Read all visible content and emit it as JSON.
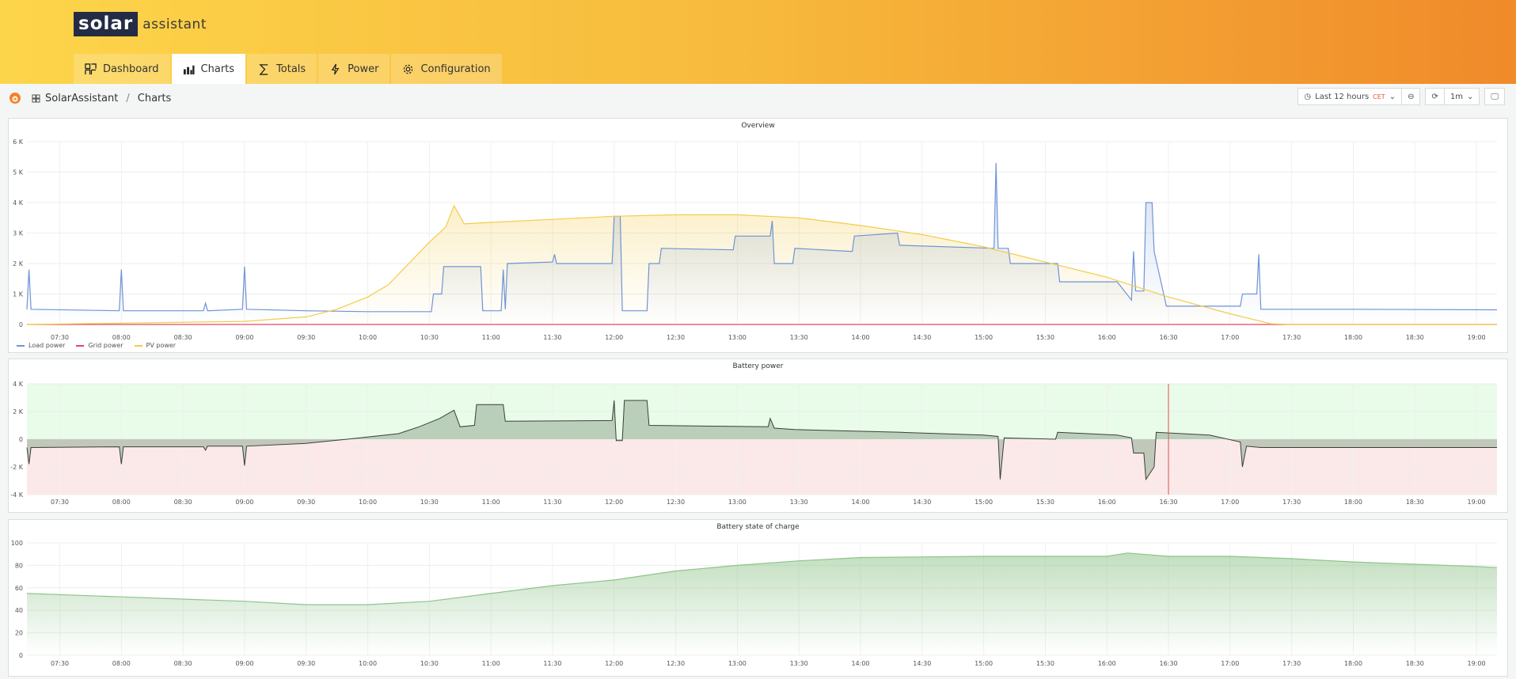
{
  "header": {
    "logo_primary": "solar",
    "logo_secondary": "assistant",
    "tabs": [
      {
        "label": "Dashboard",
        "icon": "dashboard-icon"
      },
      {
        "label": "Charts",
        "icon": "chart-icon",
        "active": true
      },
      {
        "label": "Totals",
        "icon": "sigma-icon"
      },
      {
        "label": "Power",
        "icon": "bolt-icon"
      },
      {
        "label": "Configuration",
        "icon": "gear-icon"
      }
    ]
  },
  "breadcrumb": {
    "root": "SolarAssistant",
    "separator": "/",
    "current": "Charts"
  },
  "toolbar": {
    "time_range": "Last 12 hours",
    "timezone": "CET",
    "refresh_interval": "1m"
  },
  "colors": {
    "load": "#6f93d6",
    "grid": "#e0495f",
    "pv": "#f2cc4c",
    "battery_line": "#3a3f3a",
    "battery_fill": "#9bb29b",
    "positive_zone": "#e9fbe9",
    "negative_zone": "#fbe9e9",
    "soc": "#8fc48a"
  },
  "chart_data": [
    {
      "type": "line",
      "title": "Overview",
      "xlim": [
        "07:14",
        "19:10"
      ],
      "ylim": [
        0,
        6000
      ],
      "yticks": [
        {
          "v": 0,
          "label": "0"
        },
        {
          "v": 1000,
          "label": "1 K"
        },
        {
          "v": 2000,
          "label": "2 K"
        },
        {
          "v": 3000,
          "label": "3 K"
        },
        {
          "v": 4000,
          "label": "4 K"
        },
        {
          "v": 5000,
          "label": "5 K"
        },
        {
          "v": 6000,
          "label": "6 K"
        }
      ],
      "xticks": [
        "07:30",
        "08:00",
        "08:30",
        "09:00",
        "09:30",
        "10:00",
        "10:30",
        "11:00",
        "11:30",
        "12:00",
        "12:30",
        "13:00",
        "13:30",
        "14:00",
        "14:30",
        "15:00",
        "15:30",
        "16:00",
        "16:30",
        "17:00",
        "17:30",
        "18:00",
        "18:30",
        "19:00"
      ],
      "legend": "bottom-left",
      "grid": true,
      "series": [
        {
          "name": "Load power",
          "color": "#6f93d6",
          "points": [
            [
              "07:14",
              500
            ],
            [
              "07:15",
              1800
            ],
            [
              "07:16",
              500
            ],
            [
              "07:59",
              450
            ],
            [
              "08:00",
              1800
            ],
            [
              "08:01",
              450
            ],
            [
              "08:40",
              450
            ],
            [
              "08:41",
              700
            ],
            [
              "08:42",
              450
            ],
            [
              "08:59",
              500
            ],
            [
              "09:00",
              1900
            ],
            [
              "09:01",
              500
            ],
            [
              "09:30",
              450
            ],
            [
              "10:00",
              420
            ],
            [
              "10:31",
              420
            ],
            [
              "10:32",
              1000
            ],
            [
              "10:36",
              1000
            ],
            [
              "10:37",
              1900
            ],
            [
              "10:55",
              1900
            ],
            [
              "10:56",
              450
            ],
            [
              "11:05",
              450
            ],
            [
              "11:06",
              1800
            ],
            [
              "11:07",
              500
            ],
            [
              "11:08",
              2000
            ],
            [
              "11:30",
              2050
            ],
            [
              "11:31",
              2300
            ],
            [
              "11:32",
              2000
            ],
            [
              "11:59",
              2000
            ],
            [
              "12:00",
              3550
            ],
            [
              "12:03",
              3550
            ],
            [
              "12:04",
              450
            ],
            [
              "12:16",
              450
            ],
            [
              "12:17",
              2000
            ],
            [
              "12:22",
              2000
            ],
            [
              "12:23",
              2500
            ],
            [
              "12:58",
              2450
            ],
            [
              "12:59",
              2900
            ],
            [
              "13:16",
              2900
            ],
            [
              "13:17",
              3400
            ],
            [
              "13:18",
              2000
            ],
            [
              "13:27",
              2000
            ],
            [
              "13:28",
              2500
            ],
            [
              "13:55",
              2400
            ],
            [
              "13:56",
              2400
            ],
            [
              "13:57",
              2900
            ],
            [
              "14:18",
              3000
            ],
            [
              "14:19",
              2600
            ],
            [
              "15:05",
              2500
            ],
            [
              "15:06",
              5300
            ],
            [
              "15:07",
              2500
            ],
            [
              "15:12",
              2500
            ],
            [
              "15:13",
              2000
            ],
            [
              "15:36",
              2000
            ],
            [
              "15:37",
              1400
            ],
            [
              "16:05",
              1400
            ],
            [
              "16:12",
              800
            ],
            [
              "16:13",
              2400
            ],
            [
              "16:14",
              1100
            ],
            [
              "16:18",
              1100
            ],
            [
              "16:19",
              4000
            ],
            [
              "16:22",
              4000
            ],
            [
              "16:23",
              2400
            ],
            [
              "16:29",
              600
            ],
            [
              "17:05",
              600
            ],
            [
              "17:06",
              1000
            ],
            [
              "17:13",
              1000
            ],
            [
              "17:14",
              2300
            ],
            [
              "17:15",
              500
            ],
            [
              "18:00",
              500
            ],
            [
              "19:10",
              480
            ]
          ]
        },
        {
          "name": "Grid power",
          "color": "#e0495f",
          "points": [
            [
              "07:14",
              0
            ],
            [
              "19:10",
              0
            ]
          ]
        },
        {
          "name": "PV power",
          "color": "#f2cc4c",
          "points": [
            [
              "07:14",
              0
            ],
            [
              "09:00",
              100
            ],
            [
              "09:30",
              250
            ],
            [
              "09:45",
              500
            ],
            [
              "10:00",
              900
            ],
            [
              "10:10",
              1300
            ],
            [
              "10:20",
              2000
            ],
            [
              "10:30",
              2700
            ],
            [
              "10:38",
              3200
            ],
            [
              "10:42",
              3900
            ],
            [
              "10:47",
              3300
            ],
            [
              "11:00",
              3350
            ],
            [
              "11:30",
              3450
            ],
            [
              "12:00",
              3550
            ],
            [
              "12:30",
              3600
            ],
            [
              "13:00",
              3600
            ],
            [
              "13:30",
              3500
            ],
            [
              "14:00",
              3250
            ],
            [
              "14:30",
              2950
            ],
            [
              "15:00",
              2550
            ],
            [
              "15:30",
              2050
            ],
            [
              "16:00",
              1550
            ],
            [
              "16:30",
              900
            ],
            [
              "17:00",
              350
            ],
            [
              "17:20",
              20
            ],
            [
              "17:30",
              0
            ],
            [
              "19:10",
              0
            ]
          ]
        }
      ]
    },
    {
      "type": "area",
      "title": "Battery power",
      "xlim": [
        "07:14",
        "19:10"
      ],
      "ylim": [
        -4000,
        4000
      ],
      "yticks": [
        {
          "v": -4000,
          "label": "-4 K"
        },
        {
          "v": -2000,
          "label": "-2 K"
        },
        {
          "v": 0,
          "label": "0"
        },
        {
          "v": 2000,
          "label": "2 K"
        },
        {
          "v": 4000,
          "label": "4 K"
        }
      ],
      "marker_time": "16:30",
      "grid": true,
      "points": [
        [
          "07:14",
          -600
        ],
        [
          "07:15",
          -1800
        ],
        [
          "07:16",
          -600
        ],
        [
          "07:59",
          -550
        ],
        [
          "08:00",
          -1800
        ],
        [
          "08:01",
          -550
        ],
        [
          "08:40",
          -550
        ],
        [
          "08:41",
          -800
        ],
        [
          "08:42",
          -500
        ],
        [
          "08:59",
          -500
        ],
        [
          "09:00",
          -1900
        ],
        [
          "09:01",
          -500
        ],
        [
          "09:30",
          -300
        ],
        [
          "09:50",
          0
        ],
        [
          "10:15",
          400
        ],
        [
          "10:25",
          900
        ],
        [
          "10:35",
          1500
        ],
        [
          "10:42",
          2100
        ],
        [
          "10:45",
          900
        ],
        [
          "10:52",
          1000
        ],
        [
          "10:53",
          2500
        ],
        [
          "11:06",
          2500
        ],
        [
          "11:07",
          1300
        ],
        [
          "11:59",
          1350
        ],
        [
          "12:00",
          2800
        ],
        [
          "12:01",
          -100
        ],
        [
          "12:04",
          -100
        ],
        [
          "12:05",
          2800
        ],
        [
          "12:16",
          2800
        ],
        [
          "12:17",
          1000
        ],
        [
          "13:15",
          900
        ],
        [
          "13:16",
          1500
        ],
        [
          "13:18",
          800
        ],
        [
          "13:28",
          700
        ],
        [
          "14:20",
          500
        ],
        [
          "15:00",
          300
        ],
        [
          "15:07",
          200
        ],
        [
          "15:08",
          -2900
        ],
        [
          "15:10",
          100
        ],
        [
          "15:35",
          0
        ],
        [
          "15:36",
          500
        ],
        [
          "16:05",
          300
        ],
        [
          "16:12",
          100
        ],
        [
          "16:13",
          -1000
        ],
        [
          "16:18",
          -1000
        ],
        [
          "16:19",
          -2900
        ],
        [
          "16:23",
          -2000
        ],
        [
          "16:24",
          500
        ],
        [
          "16:50",
          300
        ],
        [
          "17:05",
          -200
        ],
        [
          "17:06",
          -2000
        ],
        [
          "17:08",
          -500
        ],
        [
          "17:15",
          -600
        ],
        [
          "19:10",
          -600
        ]
      ]
    },
    {
      "type": "area",
      "title": "Battery state of charge",
      "xlim": [
        "07:14",
        "19:10"
      ],
      "ylim": [
        0,
        100
      ],
      "yticks": [
        {
          "v": 0,
          "label": "0"
        },
        {
          "v": 20,
          "label": "20"
        },
        {
          "v": 40,
          "label": "40"
        },
        {
          "v": 60,
          "label": "60"
        },
        {
          "v": 80,
          "label": "80"
        },
        {
          "v": 100,
          "label": "100"
        }
      ],
      "grid": true,
      "points": [
        [
          "07:14",
          55
        ],
        [
          "08:00",
          52
        ],
        [
          "09:00",
          48
        ],
        [
          "09:30",
          45
        ],
        [
          "10:00",
          45
        ],
        [
          "10:30",
          48
        ],
        [
          "11:00",
          55
        ],
        [
          "11:30",
          62
        ],
        [
          "12:00",
          67
        ],
        [
          "12:30",
          75
        ],
        [
          "13:00",
          80
        ],
        [
          "13:30",
          84
        ],
        [
          "14:00",
          87
        ],
        [
          "15:00",
          88
        ],
        [
          "16:00",
          88
        ],
        [
          "16:10",
          91
        ],
        [
          "16:30",
          88
        ],
        [
          "17:00",
          88
        ],
        [
          "17:30",
          86
        ],
        [
          "18:00",
          83
        ],
        [
          "18:30",
          81
        ],
        [
          "19:00",
          79
        ],
        [
          "19:10",
          78
        ]
      ]
    }
  ]
}
